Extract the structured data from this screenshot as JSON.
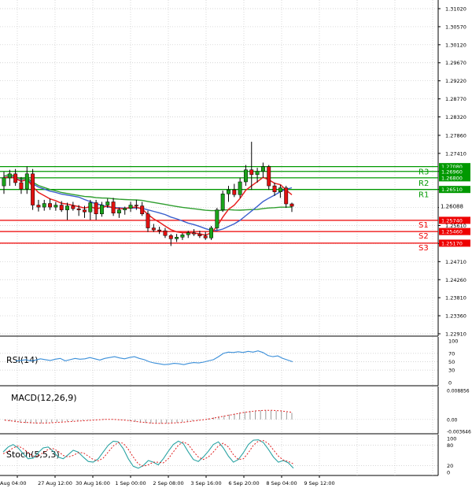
{
  "chart_data": [
    {
      "panel": "price",
      "type": "candlestick",
      "title": "",
      "ylim": [
        1.2291,
        1.3102
      ],
      "y_ticks": [
        "1.31020",
        "1.30570",
        "1.30120",
        "1.29670",
        "1.29220",
        "1.28770",
        "1.28320",
        "1.27860",
        "1.27410",
        "1.26960",
        "1.26510",
        "1.26060",
        "1.25610",
        "1.25160",
        "1.24710",
        "1.24260",
        "1.23810",
        "1.23360",
        "1.22910"
      ],
      "candles_ohlc": [
        [
          1.266,
          1.2695,
          1.264,
          1.268
        ],
        [
          1.268,
          1.27,
          1.266,
          1.269
        ],
        [
          1.269,
          1.2702,
          1.266,
          1.2668
        ],
        [
          1.2668,
          1.2682,
          1.264,
          1.2652
        ],
        [
          1.2652,
          1.2708,
          1.264,
          1.269
        ],
        [
          1.269,
          1.2702,
          1.26,
          1.2612
        ],
        [
          1.2612,
          1.2625,
          1.2596,
          1.2607
        ],
        [
          1.2607,
          1.2625,
          1.2598,
          1.2616
        ],
        [
          1.2616,
          1.2628,
          1.26,
          1.2607
        ],
        [
          1.2607,
          1.262,
          1.2598,
          1.2612
        ],
        [
          1.2612,
          1.2622,
          1.2595,
          1.26
        ],
        [
          1.26,
          1.2618,
          1.2575,
          1.261
        ],
        [
          1.261,
          1.262,
          1.2598,
          1.2603
        ],
        [
          1.2603,
          1.2612,
          1.2585,
          1.26
        ],
        [
          1.26,
          1.261,
          1.258,
          1.2595
        ],
        [
          1.2595,
          1.2625,
          1.2575,
          1.2618
        ],
        [
          1.2618,
          1.2625,
          1.2575,
          1.259
        ],
        [
          1.259,
          1.262,
          1.2583,
          1.2612
        ],
        [
          1.2612,
          1.2628,
          1.2605,
          1.262
        ],
        [
          1.262,
          1.263,
          1.2585,
          1.2592
        ],
        [
          1.2592,
          1.2606,
          1.258,
          1.26
        ],
        [
          1.26,
          1.2608,
          1.2588,
          1.2604
        ],
        [
          1.2604,
          1.262,
          1.2595,
          1.2612
        ],
        [
          1.2612,
          1.2625,
          1.26,
          1.261
        ],
        [
          1.261,
          1.262,
          1.2585,
          1.259
        ],
        [
          1.259,
          1.2598,
          1.2545,
          1.2555
        ],
        [
          1.2555,
          1.2565,
          1.2545,
          1.255
        ],
        [
          1.255,
          1.2558,
          1.254,
          1.2548
        ],
        [
          1.2548,
          1.2555,
          1.253,
          1.2536
        ],
        [
          1.2536,
          1.254,
          1.251,
          1.2528
        ],
        [
          1.2528,
          1.254,
          1.252,
          1.2532
        ],
        [
          1.2532,
          1.2542,
          1.2525,
          1.2538
        ],
        [
          1.2538,
          1.2548,
          1.253,
          1.2543
        ],
        [
          1.2543,
          1.2552,
          1.2535,
          1.254
        ],
        [
          1.254,
          1.2548,
          1.253,
          1.2535
        ],
        [
          1.2535,
          1.2545,
          1.2525,
          1.253
        ],
        [
          1.253,
          1.256,
          1.2525,
          1.2555
        ],
        [
          1.2555,
          1.2605,
          1.255,
          1.26
        ],
        [
          1.26,
          1.2648,
          1.2595,
          1.264
        ],
        [
          1.264,
          1.266,
          1.262,
          1.265
        ],
        [
          1.265,
          1.2665,
          1.2632,
          1.2638
        ],
        [
          1.2638,
          1.268,
          1.263,
          1.267
        ],
        [
          1.267,
          1.2712,
          1.266,
          1.27
        ],
        [
          1.27,
          1.277,
          1.265,
          1.2688
        ],
        [
          1.2688,
          1.2705,
          1.2668,
          1.2696
        ],
        [
          1.2696,
          1.2718,
          1.268,
          1.2708
        ],
        [
          1.2708,
          1.2712,
          1.265,
          1.266
        ],
        [
          1.266,
          1.2668,
          1.2635,
          1.2645
        ],
        [
          1.2645,
          1.2662,
          1.263,
          1.2655
        ],
        [
          1.2655,
          1.266,
          1.2605,
          1.2615
        ],
        [
          1.2615,
          1.2618,
          1.2595,
          1.2609
        ]
      ],
      "current_price": "1.26088",
      "levels": [
        {
          "name": "R3",
          "value": "1.27080",
          "color": "#009900"
        },
        {
          "name": "",
          "value": "1.26960",
          "color": "#009900"
        },
        {
          "name": "R2",
          "value": "1.26800",
          "color": "#009900"
        },
        {
          "name": "R1",
          "value": "1.26510",
          "color": "#009900"
        },
        {
          "name": "S1",
          "value": "1.25740",
          "color": "#ee0000"
        },
        {
          "name": "S2",
          "value": "1.25460",
          "color": "#ee0000"
        },
        {
          "name": "S3",
          "value": "1.25170",
          "color": "#ee0000"
        }
      ],
      "x_ticks": [
        "Aug 04:00",
        "27 Aug 12:00",
        "30 Aug 16:00",
        "1 Sep 00:00",
        "2 Sep 08:00",
        "3 Sep 16:00",
        "6 Sep 20:00",
        "8 Sep 04:00",
        "9 Sep 12:00"
      ],
      "ma_colors": {
        "fast": "#e82020",
        "mid": "#3a5fcd",
        "slow": "#2e9e2e"
      }
    },
    {
      "panel": "rsi",
      "type": "line",
      "title": "RSI(14)",
      "ylim": [
        0,
        100
      ],
      "y_ticks": [
        "100",
        "70",
        "50",
        "30",
        "0"
      ],
      "values": [
        52,
        53,
        55,
        52,
        54,
        57,
        55,
        53,
        56,
        58,
        52,
        55,
        58,
        56,
        57,
        60,
        57,
        54,
        58,
        60,
        62,
        59,
        57,
        60,
        62,
        58,
        55,
        50,
        47,
        45,
        43,
        44,
        46,
        45,
        43,
        46,
        48,
        47,
        49,
        52,
        55,
        62,
        70,
        73,
        72,
        74,
        72,
        75,
        73,
        76,
        72,
        65,
        62,
        64,
        58,
        54,
        50
      ]
    },
    {
      "panel": "macd",
      "type": "bar",
      "title": "MACD(12,26,9)",
      "ylim": [
        -0.003646,
        0.008856
      ],
      "y_ticks": [
        "0.008856",
        "0.00",
        "-0.003646"
      ],
      "hist": [
        -0.0003,
        -0.0005,
        -0.0008,
        -0.001,
        -0.0011,
        -0.0012,
        -0.0013,
        -0.0012,
        -0.0011,
        -0.0009,
        -0.0008,
        -0.0007,
        -0.0006,
        -0.0005,
        -0.0004,
        -0.0003,
        -0.0002,
        -0.0001,
        0.0,
        0.0001,
        0.0001,
        0.0,
        -0.0001,
        -0.0003,
        -0.0005,
        -0.0007,
        -0.0009,
        -0.0011,
        -0.0012,
        -0.0013,
        -0.0013,
        -0.0012,
        -0.0011,
        -0.001,
        -0.0008,
        -0.0006,
        -0.0004,
        -0.0002,
        0.0,
        0.0003,
        0.0006,
        0.0009,
        0.0012,
        0.0015,
        0.0018,
        0.0021,
        0.0024,
        0.0026,
        0.0027,
        0.0028,
        0.0028,
        0.0027,
        0.0026,
        0.0025,
        0.0022,
        0.002
      ],
      "signal": [
        -0.0002,
        -0.0004,
        -0.0006,
        -0.0008,
        -0.0009,
        -0.001,
        -0.0011,
        -0.0011,
        -0.0011,
        -0.001,
        -0.0009,
        -0.0008,
        -0.0007,
        -0.0006,
        -0.0005,
        -0.0004,
        -0.0003,
        -0.0002,
        -0.0001,
        0.0,
        0.0,
        0.0,
        -0.0001,
        -0.0002,
        -0.0004,
        -0.0006,
        -0.0008,
        -0.0009,
        -0.0011,
        -0.0012,
        -0.0012,
        -0.0012,
        -0.0011,
        -0.001,
        -0.0009,
        -0.0007,
        -0.0005,
        -0.0003,
        -0.0001,
        0.0001,
        0.0004,
        0.0007,
        0.001,
        0.0013,
        0.0016,
        0.0019,
        0.0022,
        0.0024,
        0.0026,
        0.0027,
        0.0028,
        0.0028,
        0.0027,
        0.0026,
        0.0024,
        0.0022
      ]
    },
    {
      "panel": "stoch",
      "type": "line",
      "title": "Stoch(5,5,3)",
      "ylim": [
        0,
        100
      ],
      "y_ticks": [
        "100",
        "80",
        "20",
        "0"
      ],
      "k_values": [
        60,
        75,
        82,
        72,
        55,
        40,
        42,
        58,
        72,
        75,
        62,
        45,
        40,
        52,
        65,
        60,
        45,
        32,
        30,
        40,
        60,
        80,
        92,
        90,
        70,
        40,
        18,
        12,
        20,
        35,
        30,
        22,
        40,
        62,
        82,
        92,
        85,
        60,
        38,
        32,
        45,
        62,
        82,
        90,
        72,
        48,
        30,
        38,
        58,
        82,
        95,
        96,
        88,
        68,
        45,
        30,
        35,
        28,
        12
      ],
      "d_values": [
        55,
        62,
        72,
        78,
        70,
        58,
        48,
        48,
        58,
        68,
        70,
        62,
        50,
        45,
        50,
        58,
        58,
        48,
        38,
        34,
        42,
        60,
        78,
        88,
        86,
        68,
        45,
        25,
        18,
        22,
        30,
        30,
        28,
        40,
        60,
        80,
        90,
        82,
        62,
        45,
        38,
        45,
        60,
        78,
        86,
        75,
        52,
        38,
        40,
        58,
        80,
        92,
        94,
        85,
        66,
        48,
        36,
        32,
        25
      ]
    }
  ]
}
